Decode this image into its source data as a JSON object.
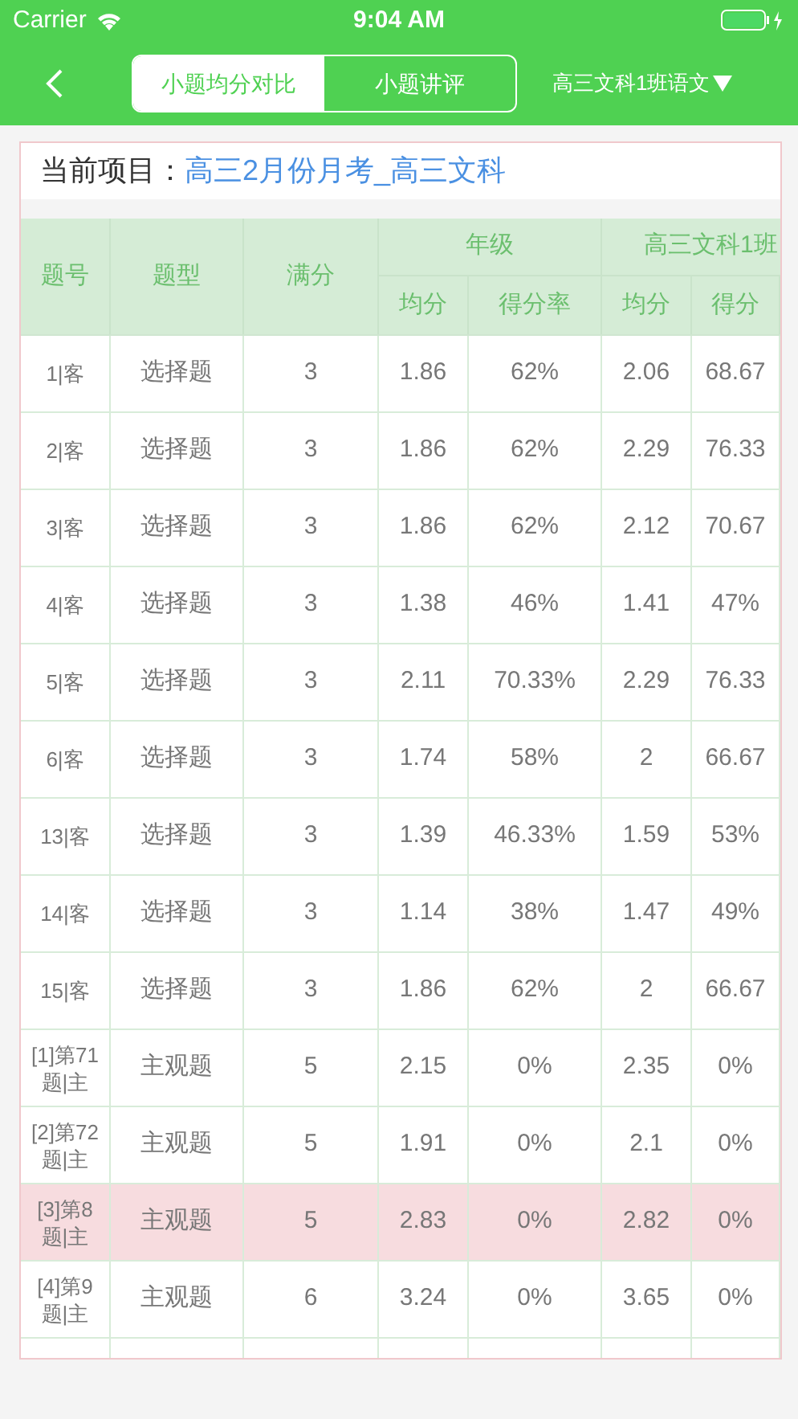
{
  "status_bar": {
    "carrier": "Carrier",
    "time": "9:04 AM"
  },
  "nav": {
    "tabs": [
      {
        "label": "小题均分对比",
        "selected": true
      },
      {
        "label": "小题讲评",
        "selected": false
      }
    ],
    "class_selector": "高三文科1班语文"
  },
  "project": {
    "label": "当前项目：",
    "value": "高三2月份月考_高三文科"
  },
  "table": {
    "columns": [
      "题号",
      "题型",
      "满分"
    ],
    "groups": [
      {
        "title": "年级",
        "columns": [
          "均分",
          "得分率"
        ]
      },
      {
        "title": "高三文科1班",
        "columns": [
          "均分",
          "得分"
        ]
      }
    ],
    "rows": [
      {
        "cells": [
          "1|客",
          "选择题",
          "3",
          "1.86",
          "62%",
          "2.06",
          "68.67"
        ],
        "highlighted": false
      },
      {
        "cells": [
          "2|客",
          "选择题",
          "3",
          "1.86",
          "62%",
          "2.29",
          "76.33"
        ],
        "highlighted": false
      },
      {
        "cells": [
          "3|客",
          "选择题",
          "3",
          "1.86",
          "62%",
          "2.12",
          "70.67"
        ],
        "highlighted": false
      },
      {
        "cells": [
          "4|客",
          "选择题",
          "3",
          "1.38",
          "46%",
          "1.41",
          "47%"
        ],
        "highlighted": false
      },
      {
        "cells": [
          "5|客",
          "选择题",
          "3",
          "2.11",
          "70.33%",
          "2.29",
          "76.33"
        ],
        "highlighted": false
      },
      {
        "cells": [
          "6|客",
          "选择题",
          "3",
          "1.74",
          "58%",
          "2",
          "66.67"
        ],
        "highlighted": false
      },
      {
        "cells": [
          "13|客",
          "选择题",
          "3",
          "1.39",
          "46.33%",
          "1.59",
          "53%"
        ],
        "highlighted": false
      },
      {
        "cells": [
          "14|客",
          "选择题",
          "3",
          "1.14",
          "38%",
          "1.47",
          "49%"
        ],
        "highlighted": false
      },
      {
        "cells": [
          "15|客",
          "选择题",
          "3",
          "1.86",
          "62%",
          "2",
          "66.67"
        ],
        "highlighted": false
      },
      {
        "cells": [
          "[1]第71题|主",
          "主观题",
          "5",
          "2.15",
          "0%",
          "2.35",
          "0%"
        ],
        "highlighted": false
      },
      {
        "cells": [
          "[2]第72题|主",
          "主观题",
          "5",
          "1.91",
          "0%",
          "2.1",
          "0%"
        ],
        "highlighted": false
      },
      {
        "cells": [
          "[3]第8题|主",
          "主观题",
          "5",
          "2.83",
          "0%",
          "2.82",
          "0%"
        ],
        "highlighted": true
      },
      {
        "cells": [
          "[4]第9题|主",
          "主观题",
          "6",
          "3.24",
          "0%",
          "3.65",
          "0%"
        ],
        "highlighted": false
      }
    ]
  }
}
